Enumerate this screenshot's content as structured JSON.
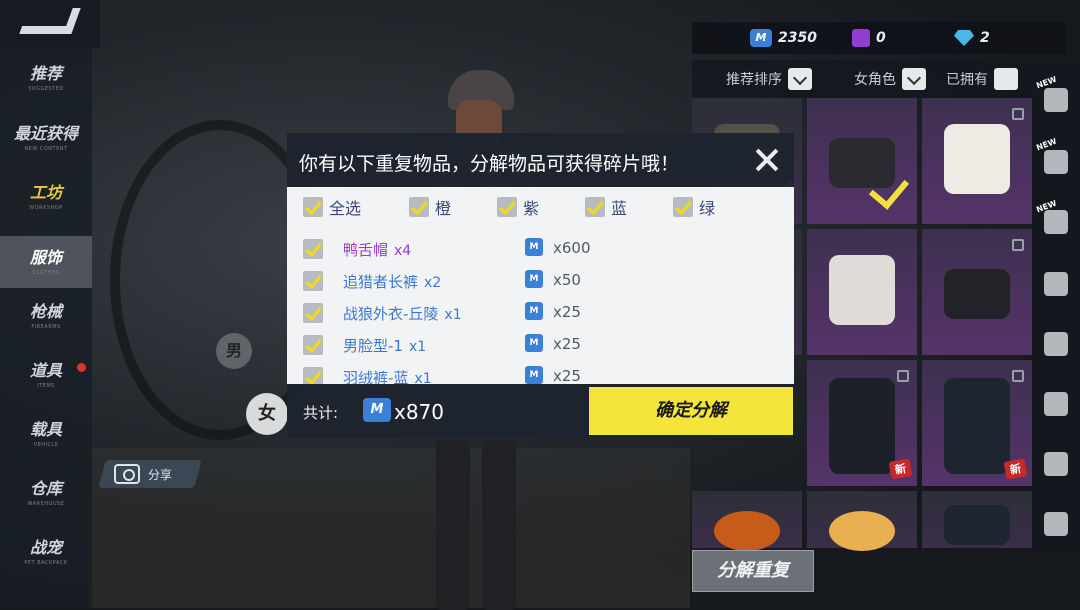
{
  "sidebar": {
    "items": [
      {
        "label": "推荐",
        "sub": "SUGGESTED"
      },
      {
        "label": "最近获得",
        "sub": "NEW CONTENT"
      },
      {
        "label": "工坊",
        "sub": "WORKSHOP"
      },
      {
        "label": "服饰",
        "sub": "CLOTHES"
      },
      {
        "label": "枪械",
        "sub": "FIREARMS"
      },
      {
        "label": "道具",
        "sub": "ITEMS"
      },
      {
        "label": "载具",
        "sub": "VEHICLE"
      },
      {
        "label": "仓库",
        "sub": "WAREHOUSE"
      },
      {
        "label": "战宠",
        "sub": "PET BACKPACK"
      }
    ]
  },
  "gender": {
    "male": "男",
    "female": "女"
  },
  "share": {
    "label": "分享"
  },
  "currency": {
    "coins": "2350",
    "fragments": "0",
    "diamonds": "2"
  },
  "filters": {
    "sort": "推荐排序",
    "gender": "女角色",
    "owned": "已拥有"
  },
  "grid_tags": {
    "worn": "着装",
    "new": "新"
  },
  "decompose_button": "分解重复",
  "modal": {
    "title": "你有以下重复物品，分解物品可获得碎片哦！",
    "filter_options": [
      "全选",
      "橙",
      "紫",
      "蓝",
      "绿"
    ],
    "items": [
      {
        "name": "鸭舌帽",
        "qty": "x4",
        "fragments": "x600",
        "rarity": "purple"
      },
      {
        "name": "追猎者长裤",
        "qty": "x2",
        "fragments": "x50",
        "rarity": "blue"
      },
      {
        "name": "战狼外衣-丘陵",
        "qty": "x1",
        "fragments": "x25",
        "rarity": "blue"
      },
      {
        "name": "男脸型-1",
        "qty": "x1",
        "fragments": "x25",
        "rarity": "blue"
      },
      {
        "name": "羽绒裤-蓝",
        "qty": "x1",
        "fragments": "x25",
        "rarity": "blue"
      }
    ],
    "total_label": "共计:",
    "total_value": "x870",
    "confirm_label": "确定分解"
  },
  "colors": {
    "accent_yellow": "#f5e43a",
    "purple_rarity": "#9a3cd0",
    "blue_rarity": "#3c78d0",
    "fragment_blue": "#3a7fd8"
  }
}
